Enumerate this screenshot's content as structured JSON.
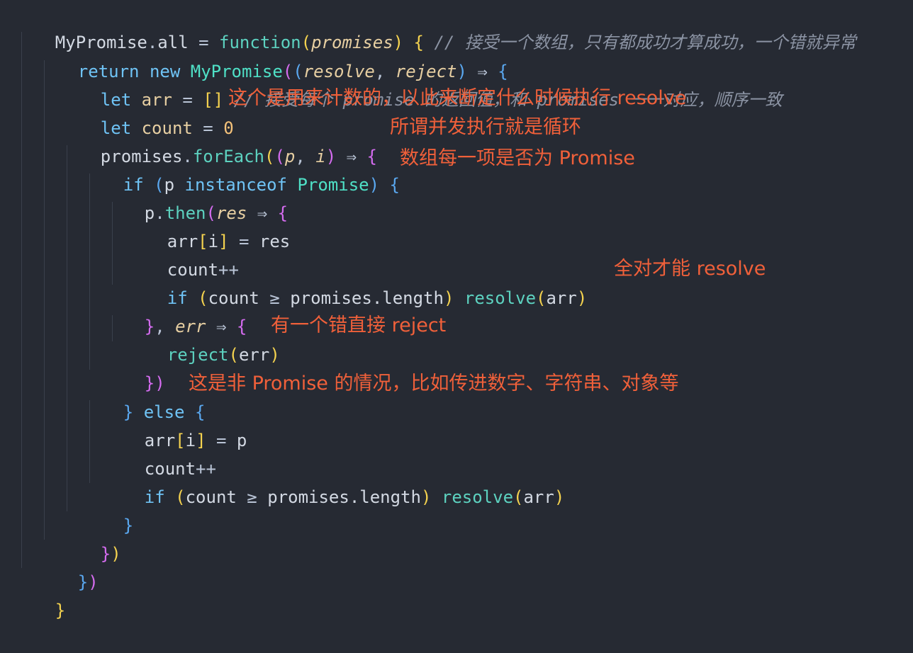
{
  "code": {
    "l1": {
      "obj": "MyPromise",
      "dot": ".",
      "prop": "all",
      "eq": " = ",
      "kw": "function",
      "open": "(",
      "param": "promises",
      "close": ")",
      "brace": " {",
      "comment": " // 接受一个数组，只有都成功才算成功，一个错就异常"
    },
    "l2": {
      "kw1": "return",
      "kw2": " new ",
      "cls": "MyPromise",
      "open1": "(",
      "open2": "(",
      "p1": "resolve",
      "comma": ", ",
      "p2": "reject",
      "close": ")",
      "arrow": " ⇒ ",
      "brace": "{"
    },
    "l3": {
      "kw": "let",
      "var": " arr",
      "eq": " = ",
      "arr": "[]",
      "comment": " // 接受每个 promise 的返回值，和 promises 一一对应，顺序一致"
    },
    "l4": {
      "kw": "let",
      "var": " count",
      "eq": " = ",
      "num": "0",
      "ann": "这个是用来计数的，以此来断定什么时候执行 resolve"
    },
    "l5": {
      "obj": "promises",
      "dot": ".",
      "fn": "forEach",
      "open1": "(",
      "open2": "(",
      "p1": "p",
      "comma": ", ",
      "p2": "i",
      "close": ")",
      "arrow": " ⇒ ",
      "brace": "{",
      "ann": "所谓并发执行就是循环"
    },
    "l6": {
      "kw": "if",
      "open": " (",
      "var": "p",
      "kw2": " instanceof ",
      "cls": "Promise",
      "close": ")",
      "brace": " {",
      "ann": "数组每一项是否为 Promise"
    },
    "l7": {
      "obj": "p",
      "dot": ".",
      "fn": "then",
      "open": "(",
      "param": "res",
      "arrow": " ⇒ ",
      "brace": "{"
    },
    "l8": {
      "var": "arr",
      "open": "[",
      "idx": "i",
      "close": "]",
      "eq": " = ",
      "val": "res"
    },
    "l9": {
      "var": "count",
      "op": "++"
    },
    "l10": {
      "kw": "if",
      "open": " (",
      "var": "count",
      "op": " ≥ ",
      "obj": "promises",
      "prop": ".length",
      "close": ")",
      "fn": " resolve",
      "open2": "(",
      "arg": "arr",
      "close2": ")",
      "ann": "全对才能 resolve"
    },
    "l11": {
      "brace": "}",
      "comma": ", ",
      "param": "err",
      "arrow": " ⇒ ",
      "brace2": "{"
    },
    "l12": {
      "fn": "reject",
      "open": "(",
      "arg": "err",
      "close": ")",
      "ann": "有一个错直接 reject"
    },
    "l13": {
      "brace": "}",
      "paren": ")"
    },
    "l14": {
      "brace": "}",
      "kw": " else ",
      "brace2": "{",
      "ann": "这是非 Promise 的情况，比如传进数字、字符串、对象等"
    },
    "l15": {
      "var": "arr",
      "open": "[",
      "idx": "i",
      "close": "]",
      "eq": " = ",
      "val": "p"
    },
    "l16": {
      "var": "count",
      "op": "++"
    },
    "l17": {
      "kw": "if",
      "open": " (",
      "var": "count",
      "op": " ≥ ",
      "obj": "promises",
      "prop": ".length",
      "close": ")",
      "fn": " resolve",
      "open2": "(",
      "arg": "arr",
      "close2": ")"
    },
    "l18": {
      "brace": "}"
    },
    "l19": {
      "brace": "}",
      "paren": ")"
    },
    "l20": {
      "brace": "}",
      "paren": ")"
    },
    "l21": {
      "brace": "}"
    }
  }
}
